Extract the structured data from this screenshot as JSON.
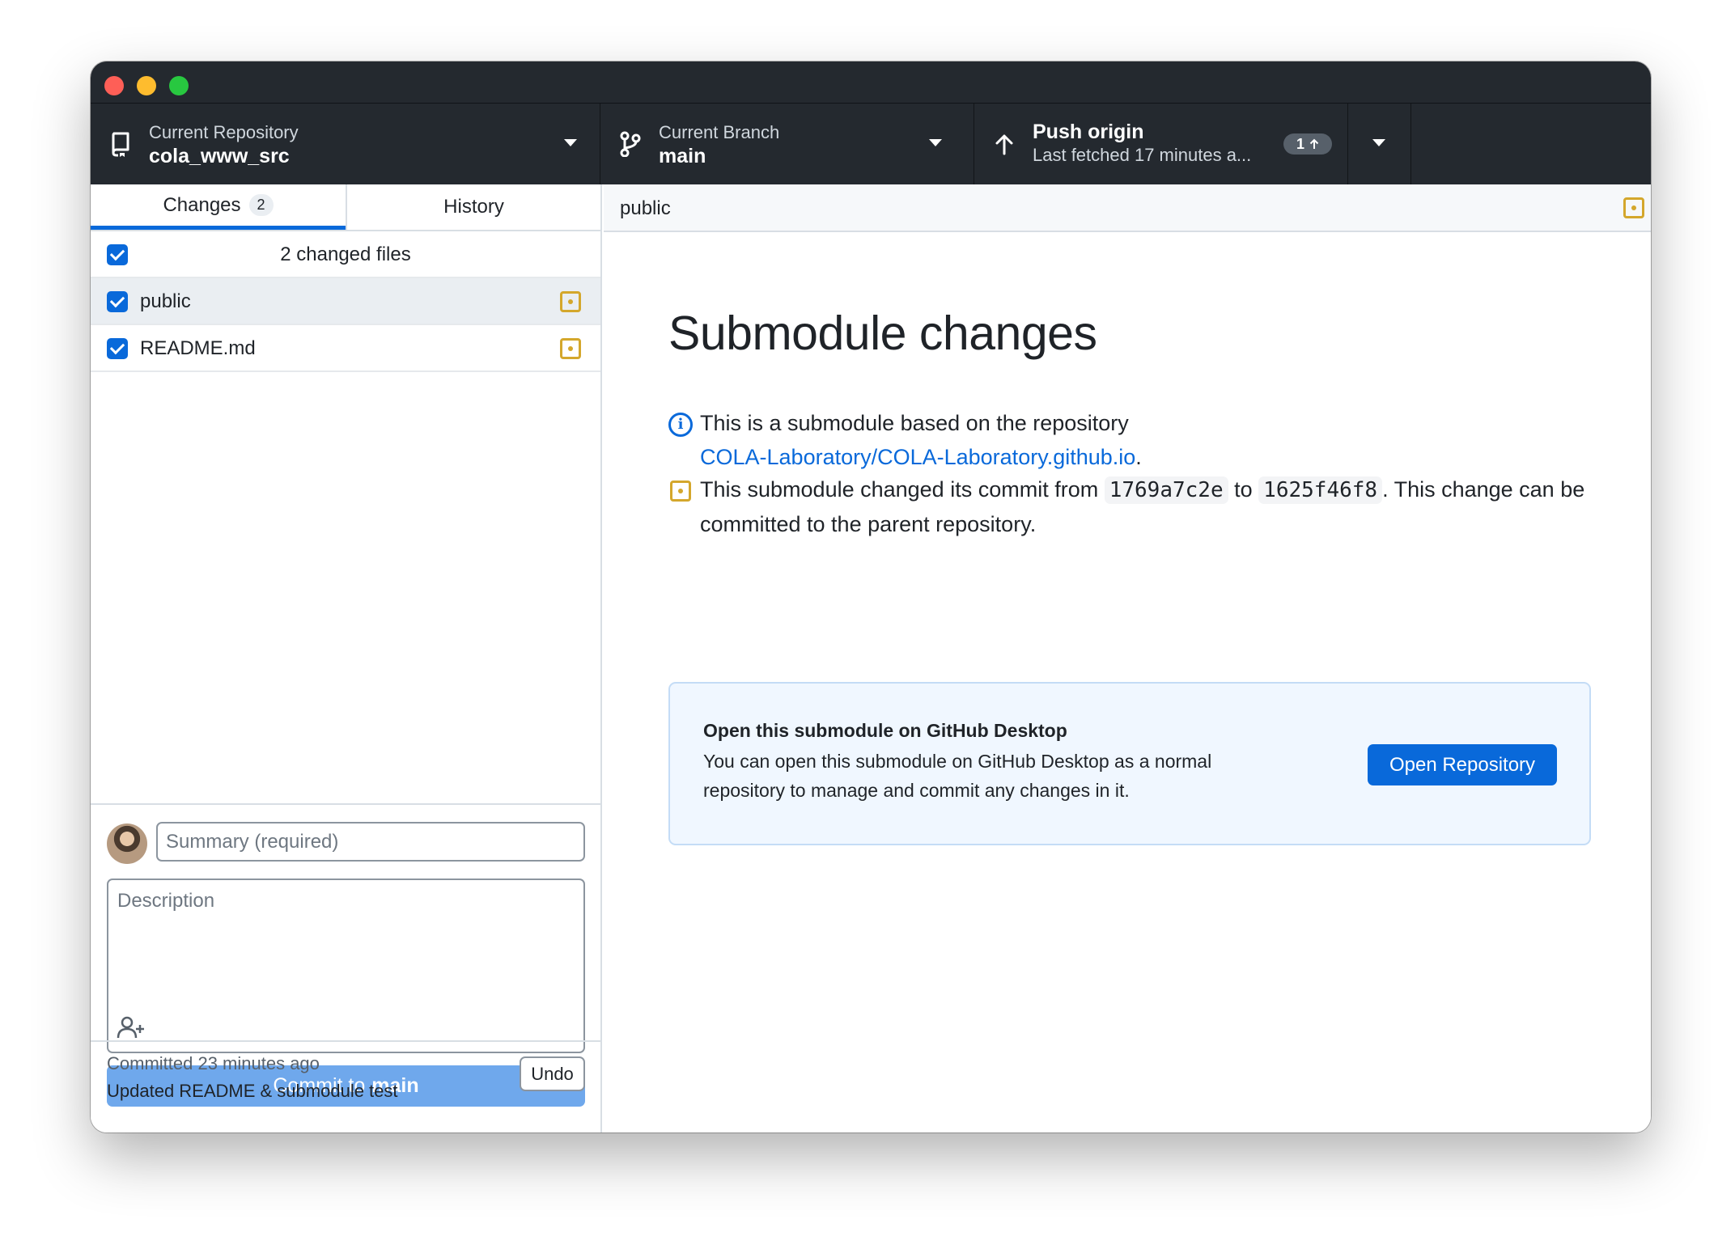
{
  "toolbar": {
    "repository": {
      "label": "Current Repository",
      "value": "cola_www_src"
    },
    "branch": {
      "label": "Current Branch",
      "value": "main"
    },
    "push": {
      "title": "Push origin",
      "subtitle": "Last fetched 17 minutes a...",
      "badge_count": "1"
    }
  },
  "sidebar": {
    "tabs": [
      {
        "label": "Changes",
        "count": "2",
        "active": true
      },
      {
        "label": "History",
        "active": false
      }
    ],
    "changed_files_header": "2 changed files",
    "files": [
      {
        "name": "public",
        "checked": true,
        "status": "modified",
        "selected": true
      },
      {
        "name": "README.md",
        "checked": true,
        "status": "modified",
        "selected": false
      }
    ],
    "commit": {
      "summary_placeholder": "Summary (required)",
      "description_placeholder": "Description",
      "button_prefix": "Commit to",
      "button_branch": "main"
    },
    "last_commit": {
      "when": "Committed 23 minutes ago",
      "message": "Updated README & submodule test",
      "undo_label": "Undo"
    }
  },
  "main": {
    "header_path": "public",
    "title": "Submodule changes",
    "info_text": "This is a submodule based on the repository",
    "repo_link": "COLA-Laboratory/COLA-Laboratory.github.io",
    "commit_text_before": "This submodule changed its commit from",
    "from_sha": "1769a7c2e",
    "to_word": "to",
    "to_sha": "1625f46f8",
    "commit_text_after": ". This change can be committed to the parent repository.",
    "callout": {
      "title": "Open this submodule on GitHub Desktop",
      "description": "You can open this submodule on GitHub Desktop as a normal repository to manage and commit any changes in it.",
      "button_label": "Open Repository"
    }
  },
  "colors": {
    "accent": "#0969da",
    "toolbar_bg": "#24292f",
    "modified": "#d4a72c",
    "commit_button_disabled": "#6fa8ec"
  },
  "icons": [
    "repo-icon",
    "branch-icon",
    "arrow-up-icon",
    "caret-down-icon",
    "info-icon",
    "file-modified-icon",
    "add-coauthor-icon"
  ]
}
